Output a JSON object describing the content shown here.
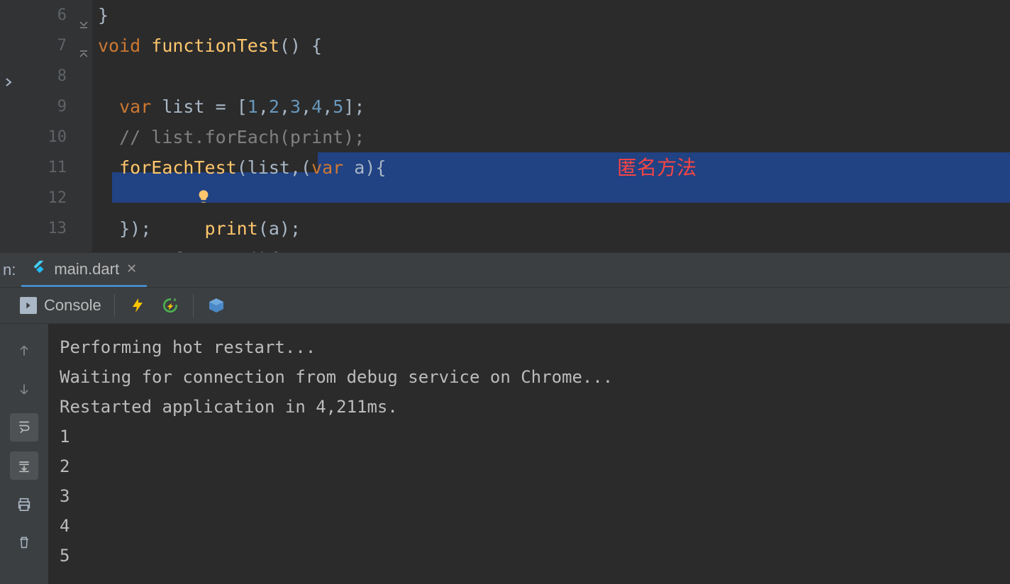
{
  "editor": {
    "lines": [
      {
        "num": "6"
      },
      {
        "num": "7"
      },
      {
        "num": "8"
      },
      {
        "num": "9"
      },
      {
        "num": "10"
      },
      {
        "num": "11"
      },
      {
        "num": "12"
      },
      {
        "num": "13"
      }
    ],
    "code": {
      "l6": "}",
      "l7_kw": "void",
      "l7_fn": "functionTest",
      "l7_rest": "() {",
      "l9_kw": "var",
      "l9_ident": "list",
      "l9_eq": " = [",
      "l9_n1": "1",
      "l9_n2": "2",
      "l9_n3": "3",
      "l9_n4": "4",
      "l9_n5": "5",
      "l9_end": "];",
      "l10": "// list.forEach(print);",
      "l11_fn": "forEachTest",
      "l11_a": "(list,",
      "l11_b": "(",
      "l11_kw": "var",
      "l11_c": " a){",
      "l12_fn": "print",
      "l12_rest": "(a);",
      "l13": "});"
    },
    "annotation": "匿名方法"
  },
  "panel": {
    "run_prefix": "n:",
    "tab_label": "main.dart",
    "console_label": "Console",
    "output": [
      "Performing hot restart...",
      "Waiting for connection from debug service on Chrome...",
      "Restarted application in 4,211ms.",
      "1",
      "2",
      "3",
      "4",
      "5"
    ]
  }
}
